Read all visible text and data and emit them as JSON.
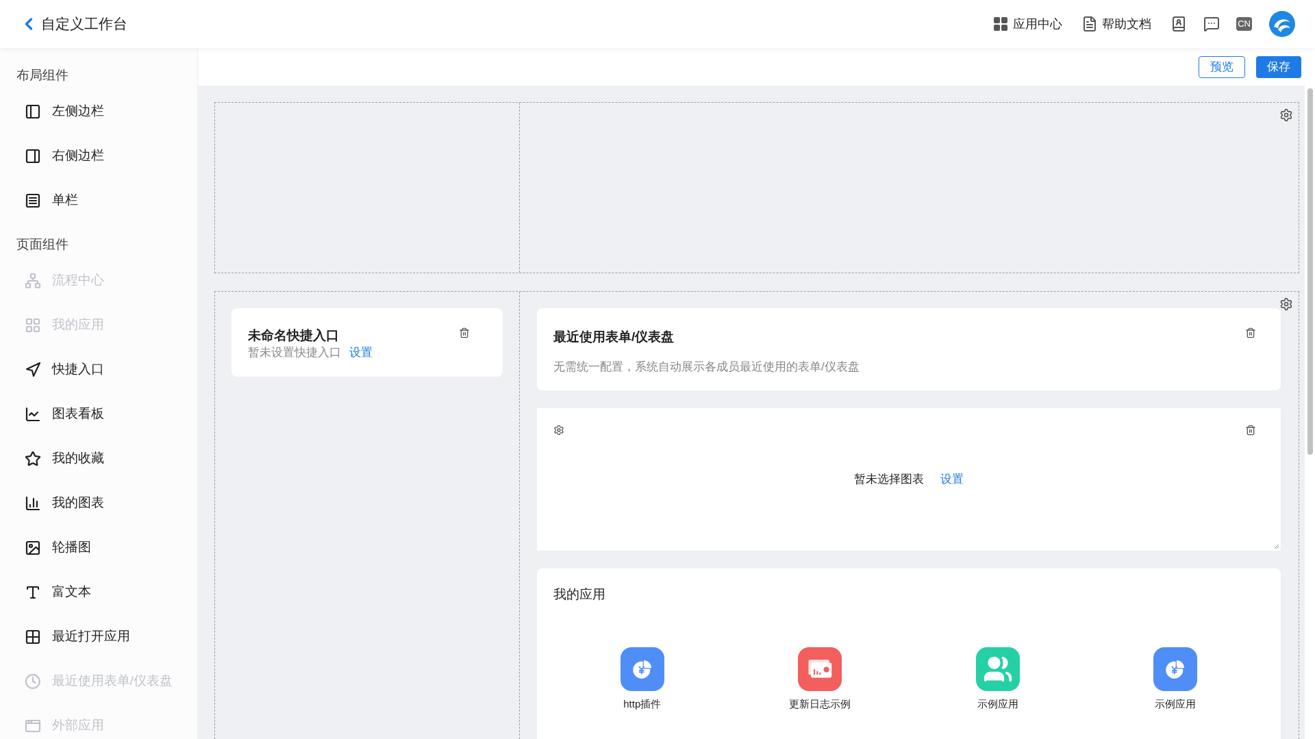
{
  "header": {
    "back_title": "自定义工作台",
    "links": [
      {
        "label": "应用中心"
      },
      {
        "label": "帮助文档"
      }
    ],
    "language": "CN"
  },
  "sidebar": {
    "sections": [
      {
        "title": "布局组件",
        "items": [
          {
            "label": "左侧边栏",
            "disabled": false
          },
          {
            "label": "右侧边栏",
            "disabled": false
          },
          {
            "label": "单栏",
            "disabled": false
          }
        ]
      },
      {
        "title": "页面组件",
        "items": [
          {
            "label": "流程中心",
            "disabled": true
          },
          {
            "label": "我的应用",
            "disabled": true
          },
          {
            "label": "快捷入口",
            "disabled": false
          },
          {
            "label": "图表看板",
            "disabled": false
          },
          {
            "label": "我的收藏",
            "disabled": false
          },
          {
            "label": "我的图表",
            "disabled": false
          },
          {
            "label": "轮播图",
            "disabled": false
          },
          {
            "label": "富文本",
            "disabled": false
          },
          {
            "label": "最近打开应用",
            "disabled": false
          },
          {
            "label": "最近使用表单/仪表盘",
            "disabled": true
          },
          {
            "label": "外部应用",
            "disabled": true
          }
        ]
      }
    ]
  },
  "toolbar": {
    "buttons": [
      {
        "label": "预览",
        "kind": "outline"
      },
      {
        "label": "保存",
        "kind": "primary"
      }
    ]
  },
  "shortcut_card": {
    "title": "未命名快捷入口",
    "note": "暂未设置快捷入口",
    "link": "设置"
  },
  "recent_card": {
    "title": "最近使用表单/仪表盘",
    "description": "无需统一配置，系统自动展示各成员最近使用的表单/仪表盘"
  },
  "chart_card": {
    "note": "暂未选择图表",
    "link": "设置"
  },
  "apps_card": {
    "title": "我的应用",
    "apps": [
      {
        "label": "http插件",
        "color": "#4f8ef7"
      },
      {
        "label": "更新日志示例",
        "color": "#f25f5c"
      },
      {
        "label": "示例应用",
        "color": "#26d0a5"
      },
      {
        "label": "示例应用",
        "color": "#4f8ef7"
      }
    ]
  }
}
